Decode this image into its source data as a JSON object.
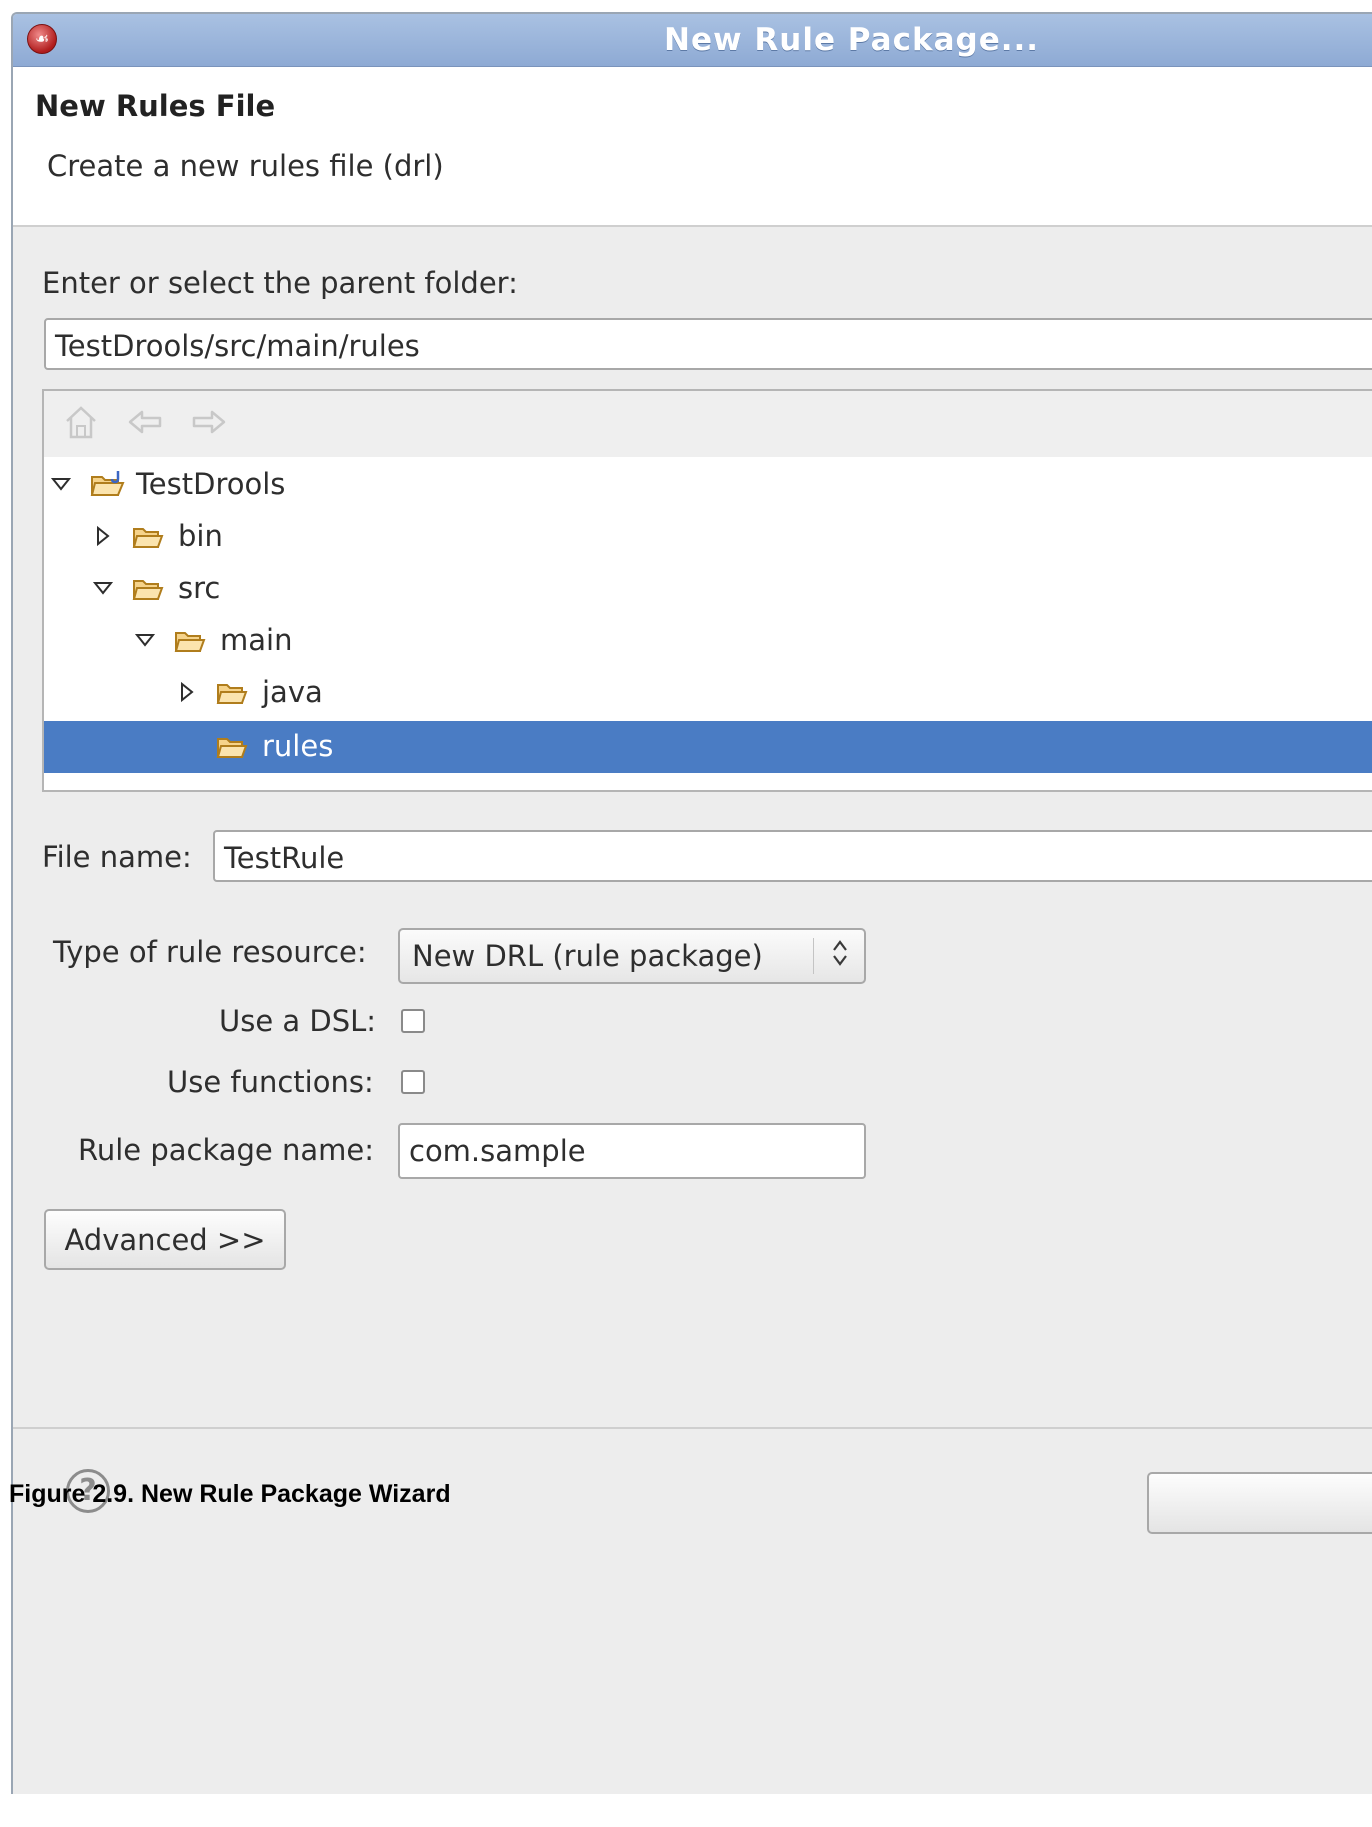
{
  "window": {
    "title": "New Rule Package..."
  },
  "header": {
    "title": "New Rules File",
    "description": "Create a new rules file (drl)"
  },
  "parent_folder": {
    "label": "Enter or select the parent folder:",
    "value": "TestDrools/src/main/rules"
  },
  "tree": {
    "toolbar": [
      "home-icon",
      "back-arrow-icon",
      "forward-arrow-icon"
    ],
    "items": [
      {
        "label": "TestDrools",
        "state": "expanded",
        "icon": "java-project-icon"
      },
      {
        "label": "bin",
        "state": "collapsed",
        "icon": "folder-icon"
      },
      {
        "label": "src",
        "state": "expanded",
        "icon": "folder-icon"
      },
      {
        "label": "main",
        "state": "expanded",
        "icon": "folder-icon"
      },
      {
        "label": "java",
        "state": "collapsed",
        "icon": "folder-icon"
      },
      {
        "label": "rules",
        "state": "leaf",
        "icon": "folder-icon",
        "selected": true
      }
    ]
  },
  "file_name": {
    "label": "File name:",
    "value": "TestRule"
  },
  "rule_resource": {
    "label": "Type of rule resource:",
    "selected": "New DRL (rule package)"
  },
  "use_dsl": {
    "label": "Use a DSL:",
    "checked": false
  },
  "use_functions": {
    "label": "Use functions:",
    "checked": false
  },
  "package_name": {
    "label": "Rule package name:",
    "value": "com.sample"
  },
  "advanced_button": "Advanced >>",
  "caption": "Figure 2.9. New Rule Package Wizard",
  "colors": {
    "selection": "#4a7cc4",
    "titlebar": "#8eaad4",
    "folder": "#f0b84a"
  }
}
